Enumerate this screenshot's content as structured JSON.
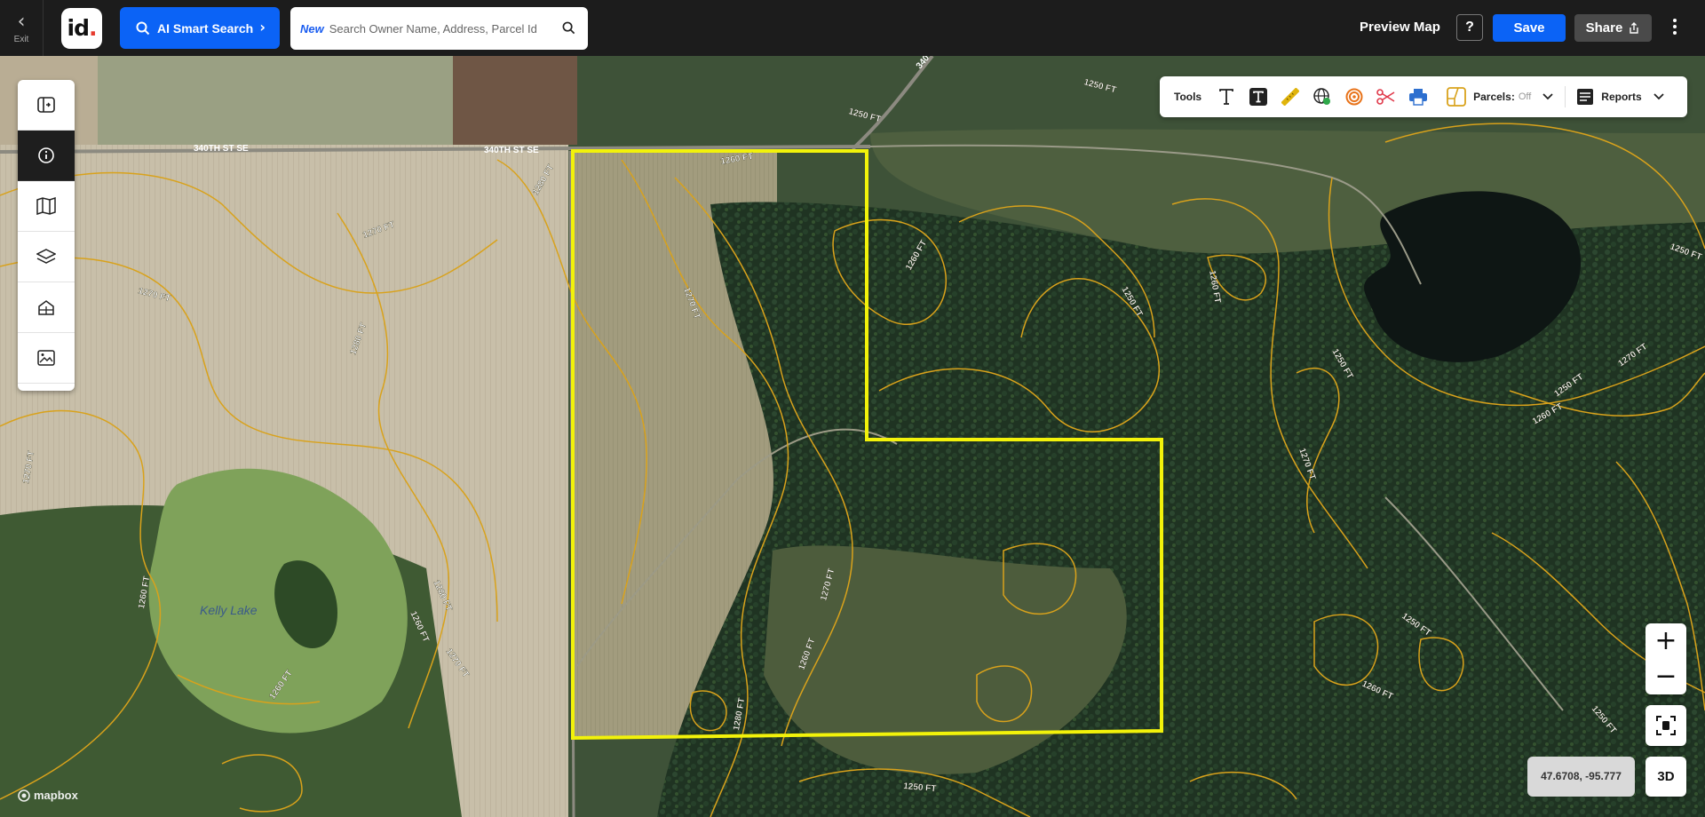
{
  "topbar": {
    "exit_label": "Exit",
    "logo_text": "id",
    "ai_search_label": "AI Smart Search",
    "search_new_tag": "New",
    "search_placeholder": "Search Owner Name, Address, Parcel Id",
    "preview_label": "Preview Map",
    "help_label": "?",
    "save_label": "Save",
    "share_label": "Share"
  },
  "left_panel": {
    "items": [
      {
        "icon": "expand-panel-icon"
      },
      {
        "icon": "info-icon"
      },
      {
        "icon": "map-icon"
      },
      {
        "icon": "layers-icon"
      },
      {
        "icon": "property-icon"
      },
      {
        "icon": "image-icon"
      }
    ]
  },
  "tools": {
    "label": "Tools",
    "items": [
      "text-icon",
      "text-box-icon",
      "ruler-icon",
      "globe-icon",
      "buffer-ring-icon",
      "scissors-icon",
      "print-icon"
    ],
    "parcels_label": "Parcels:",
    "parcels_value": "Off",
    "reports_label": "Reports"
  },
  "map": {
    "roads": [
      "340TH ST SE",
      "340TH ST SE",
      "340"
    ],
    "lake_label": "Kelly Lake",
    "contours": [
      "1260 FT",
      "1280 FT",
      "1270 FT",
      "1270 FT",
      "1280 FT",
      "1270 FT",
      "1250 FT",
      "1250 FT",
      "1260 FT",
      "1250 FT",
      "1260 FT",
      "1250 FT",
      "1270 FT",
      "1250 FT",
      "1260 FT",
      "1280 FT",
      "1260 FT",
      "1270 FT",
      "1250 FT",
      "1260 FT",
      "1270 FT",
      "1250 FT",
      "1260 FT",
      "1270 FT",
      "1280 FT",
      "1260 FT",
      "1270 FT",
      "1260 FT",
      "1250 FT",
      "1250 FT"
    ],
    "attribution": "mapbox",
    "coordinates": "47.6708, -95.777",
    "view_3d_label": "3D",
    "zoom_in": "+",
    "zoom_out": "−"
  },
  "colors": {
    "accent": "#0b63f6",
    "parcel_outline": "#f2f20a",
    "contour": "#d9a21b",
    "topbar_bg": "#1c1c1c"
  }
}
